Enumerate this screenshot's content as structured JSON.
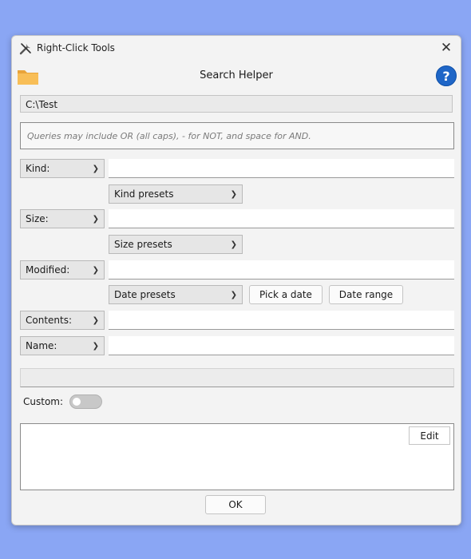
{
  "window": {
    "title": "Right-Click Tools",
    "close_symbol": "✕"
  },
  "header": {
    "title": "Search Helper",
    "help_symbol": "?"
  },
  "path": {
    "value": "C:\\Test"
  },
  "query": {
    "placeholder": "Queries may include OR (all caps),  - for NOT,  and space for AND."
  },
  "filters": {
    "kind": {
      "label": "Kind:",
      "value": ""
    },
    "kind_presets": "Kind presets",
    "size": {
      "label": "Size:",
      "value": ""
    },
    "size_presets": "Size presets",
    "modified": {
      "label": "Modified:",
      "value": ""
    },
    "date_presets": "Date presets",
    "pick_date": "Pick a date",
    "date_range": "Date range",
    "contents": {
      "label": "Contents:",
      "value": ""
    },
    "name": {
      "label": "Name:",
      "value": ""
    }
  },
  "custom": {
    "label": "Custom:",
    "enabled": false,
    "edit_label": "Edit"
  },
  "footer": {
    "ok_label": "OK"
  },
  "colors": {
    "desktop": "#8aa6f4",
    "folder": "#f6b54a",
    "help": "#1f66c7"
  }
}
